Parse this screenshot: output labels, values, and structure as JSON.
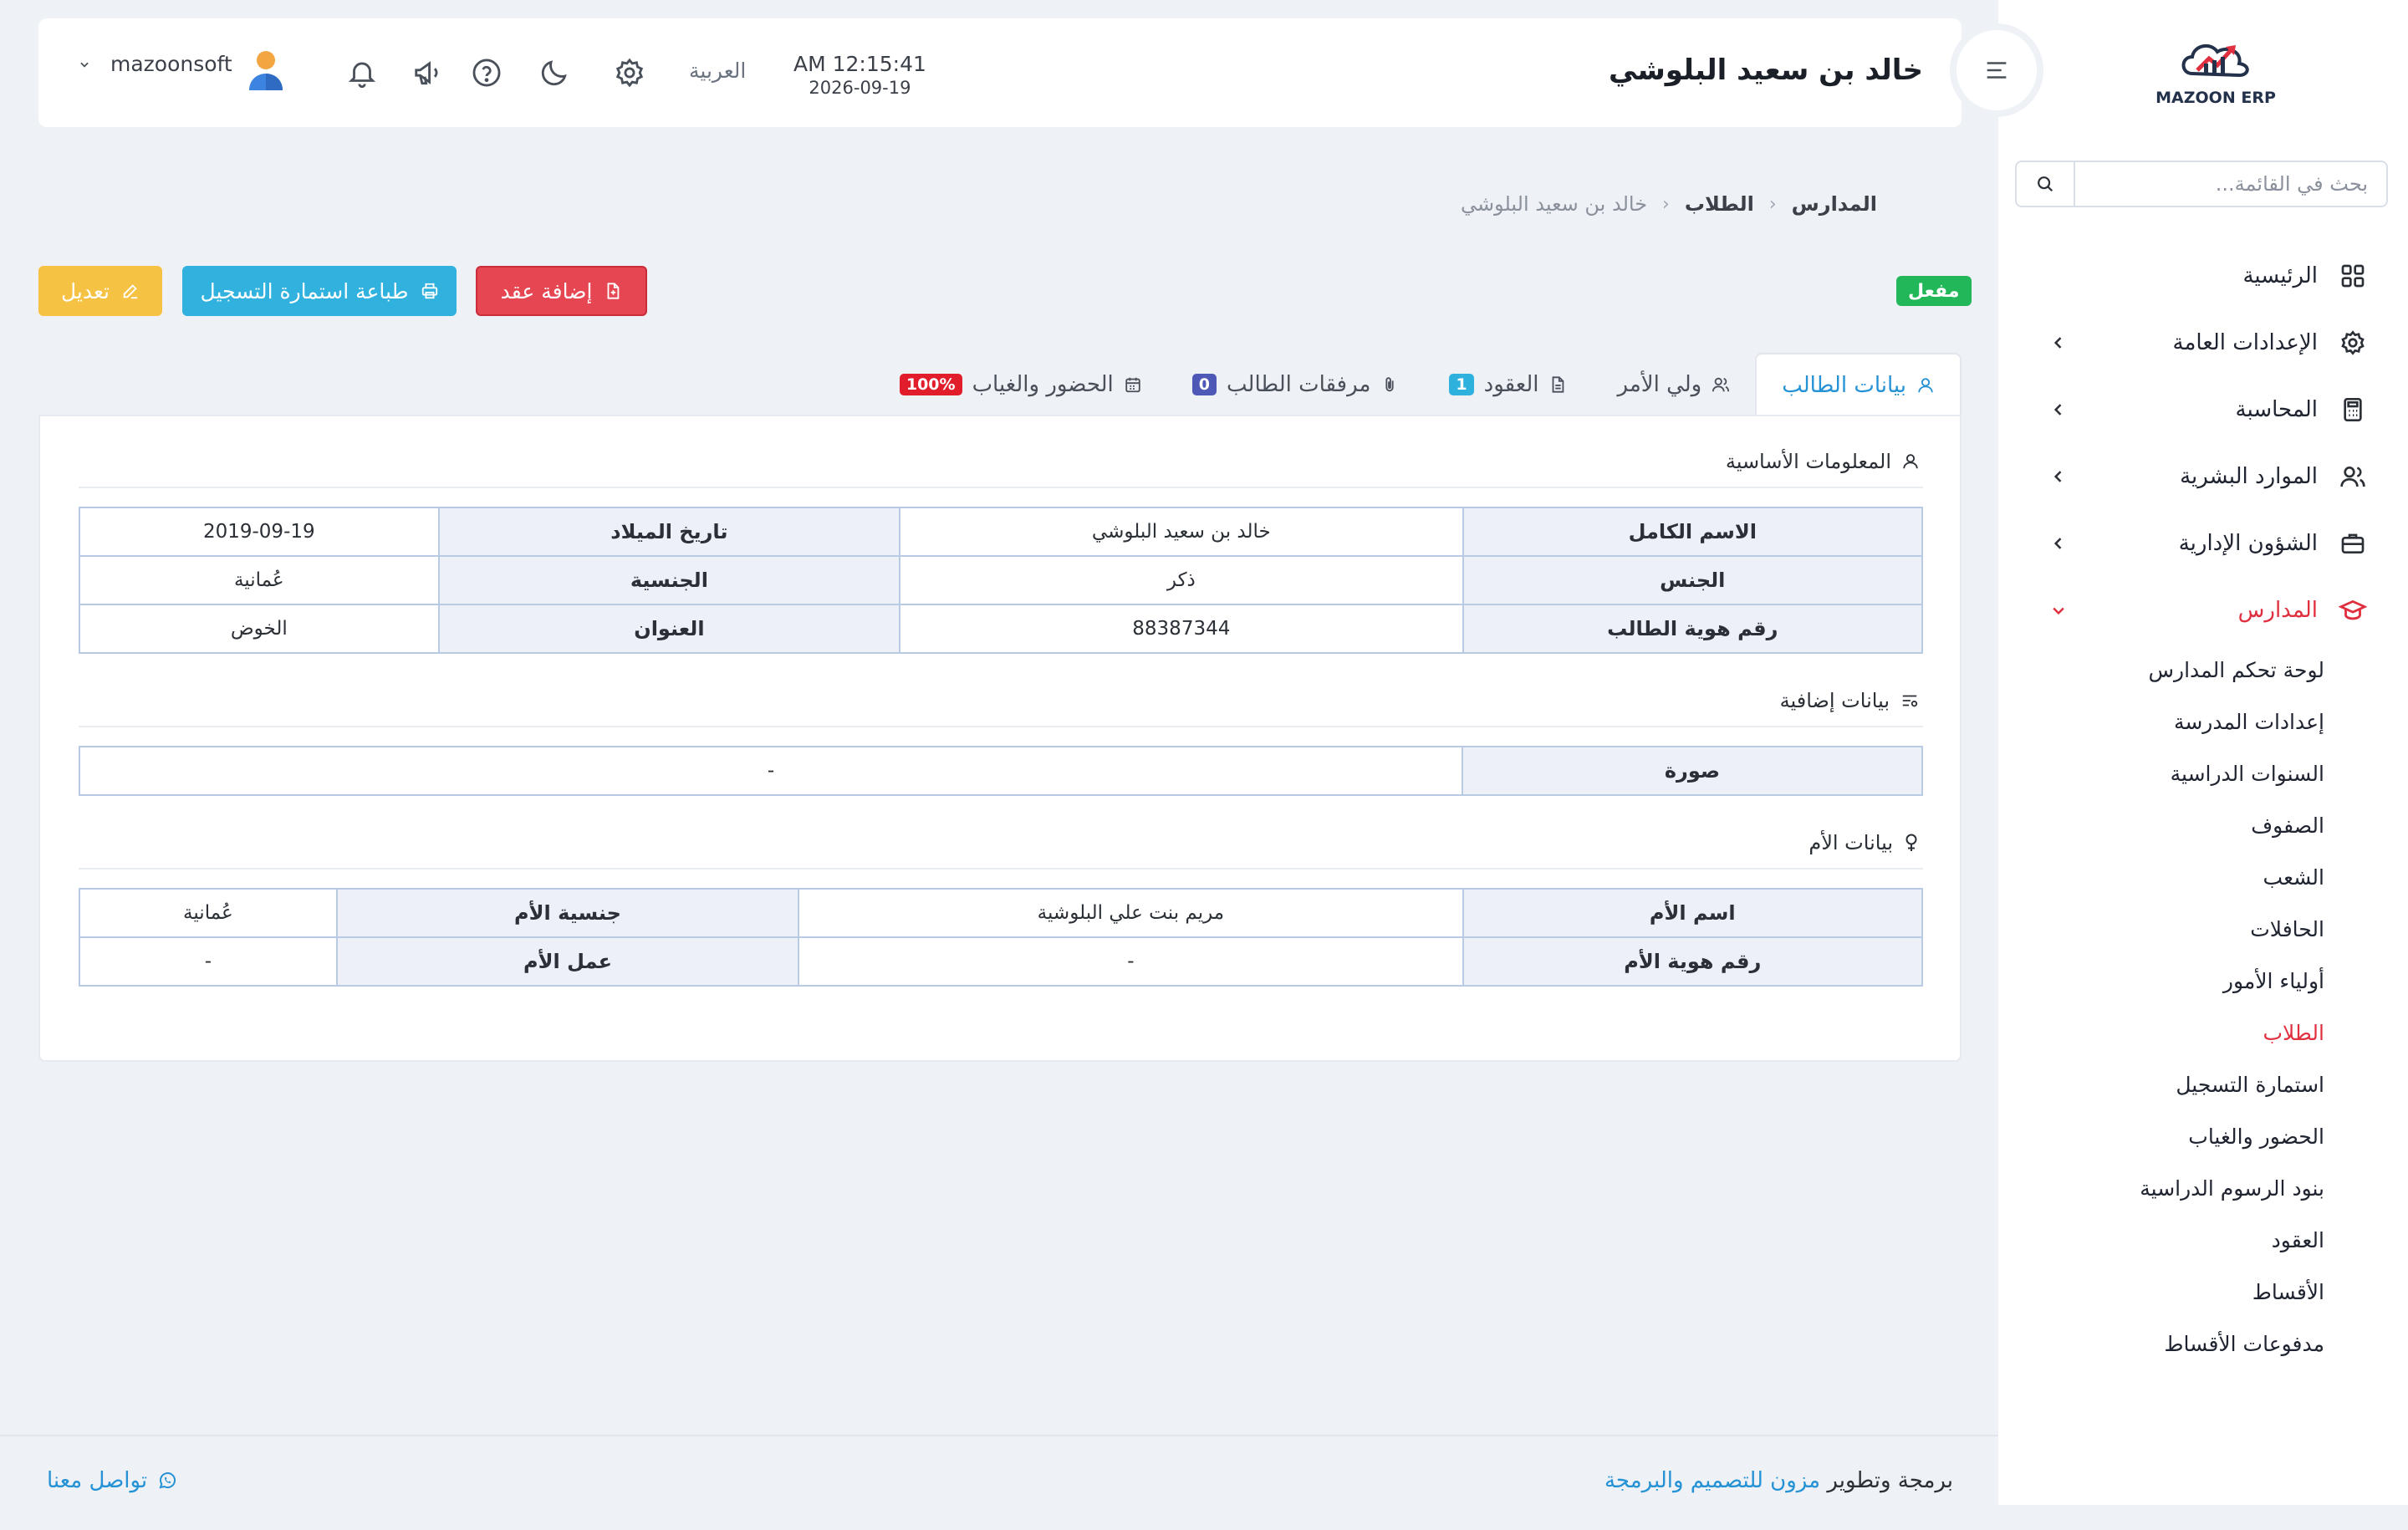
{
  "app": {
    "logo_text": "MAZOON ERP"
  },
  "sidebar": {
    "search_placeholder": "بحث في القائمة...",
    "items": [
      {
        "label": "الرئيسية",
        "icon": "grid-icon"
      },
      {
        "label": "الإعدادات العامة",
        "icon": "gear-icon"
      },
      {
        "label": "المحاسبة",
        "icon": "calculator-icon"
      },
      {
        "label": "الموارد البشرية",
        "icon": "users-icon"
      },
      {
        "label": "الشؤون الإدارية",
        "icon": "briefcase-icon"
      },
      {
        "label": "المدارس",
        "icon": "graduation-cap-icon"
      }
    ],
    "schools_submenu": [
      "لوحة تحكم المدارس",
      "إعدادات المدرسة",
      "السنوات الدراسية",
      "الصفوف",
      "الشعب",
      "الحافلات",
      "أولياء الأمور",
      "الطلاب",
      "استمارة التسجيل",
      "الحضور والغياب",
      "بنود الرسوم الدراسية",
      "العقود",
      "الأقساط",
      "مدفوعات الأقساط"
    ]
  },
  "header": {
    "title": "خالد بن سعيد البلوشي",
    "time": "AM 12:15:41",
    "date": "2026-09-19",
    "language": "العربية",
    "username": "mazoonsoft"
  },
  "breadcrumb": {
    "items": [
      "المدارس",
      "الطلاب"
    ],
    "current": "خالد بن سعيد البلوشي"
  },
  "actions": {
    "status": "مفعل",
    "add_contract": "إضافة عقد",
    "print_form": "طباعة استمارة التسجيل",
    "edit": "تعديل"
  },
  "tabs": [
    {
      "label": "بيانات الطالب",
      "icon": "user-icon"
    },
    {
      "label": "ولي الأمر",
      "icon": "users-icon"
    },
    {
      "label": "العقود",
      "icon": "document-icon",
      "badge": "1"
    },
    {
      "label": "مرفقات الطالب",
      "icon": "paperclip-icon",
      "badge": "0"
    },
    {
      "label": "الحضور والغياب",
      "icon": "calendar-icon",
      "badge": "100%"
    }
  ],
  "basic_info": {
    "title": "المعلومات الأساسية",
    "rows": [
      [
        "الاسم الكامل",
        "خالد بن سعيد البلوشي",
        "تاريخ الميلاد",
        "2019-09-19"
      ],
      [
        "الجنس",
        "ذكر",
        "الجنسية",
        "عُمانية"
      ],
      [
        "رقم هوية الطالب",
        "88387344",
        "العنوان",
        "الخوض"
      ]
    ]
  },
  "additional_info": {
    "title": "بيانات إضافية",
    "rows": [
      [
        "صورة",
        "-"
      ]
    ]
  },
  "mother_info": {
    "title": "بيانات الأم",
    "rows": [
      [
        "اسم الأم",
        "مريم بنت علي البلوشية",
        "جنسية الأم",
        "عُمانية"
      ],
      [
        "رقم هوية الأم",
        "-",
        "عمل الأم",
        "-"
      ]
    ]
  },
  "footer": {
    "credit_prefix": "برمجة وتطوير",
    "credit_link": "مزون للتصميم والبرمجة",
    "contact": "تواصل معنا"
  },
  "colors": {
    "accent_blue": "#2492d4",
    "danger": "#e64552",
    "active_menu": "#e0303f",
    "success": "#22b85a",
    "warning": "#f6c244",
    "info": "#30b1de"
  }
}
